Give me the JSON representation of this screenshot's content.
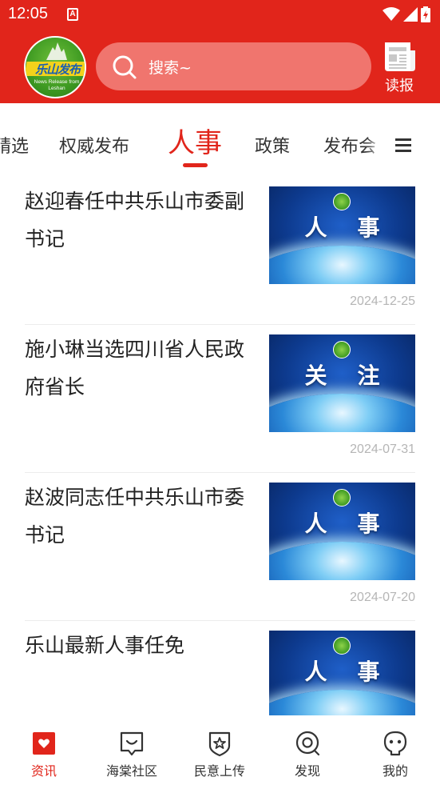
{
  "status_bar": {
    "time": "12:05",
    "app_badge": "A"
  },
  "header": {
    "logo": {
      "title": "乐山发布",
      "subtitle_line1": "News Release from",
      "subtitle_line2": "Leshan"
    },
    "search_placeholder": "搜索~",
    "read_label": "读报",
    "brand_color": "#e1251b"
  },
  "tabs": {
    "items": [
      {
        "label": "精选"
      },
      {
        "label": "权威发布"
      },
      {
        "label": "人事"
      },
      {
        "label": "政策"
      },
      {
        "label": "发布会"
      }
    ],
    "active_index": 2
  },
  "news": [
    {
      "title": "赵迎春任中共乐山市委副书记",
      "thumb_text": "人事",
      "date": "2024-12-25"
    },
    {
      "title": "施小琳当选四川省人民政府省长",
      "thumb_text": "关注",
      "date": "2024-07-31"
    },
    {
      "title": "赵波同志任中共乐山市委书记",
      "thumb_text": "人事",
      "date": "2024-07-20"
    },
    {
      "title": "乐山最新人事任免",
      "thumb_text": "人事",
      "date": ""
    }
  ],
  "bottom_nav": {
    "items": [
      {
        "label": "资讯",
        "icon": "news-icon"
      },
      {
        "label": "海棠社区",
        "icon": "community-icon"
      },
      {
        "label": "民意上传",
        "icon": "upload-icon"
      },
      {
        "label": "发现",
        "icon": "discover-icon"
      },
      {
        "label": "我的",
        "icon": "profile-icon"
      }
    ],
    "active_index": 0
  }
}
